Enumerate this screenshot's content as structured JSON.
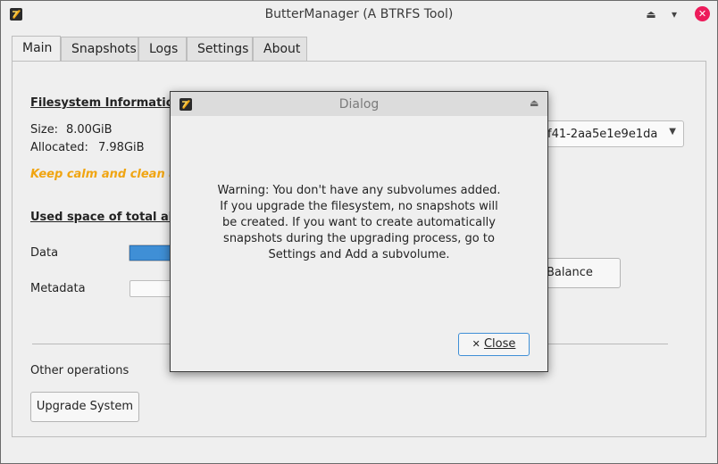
{
  "window": {
    "title": "ButterManager (A BTRFS Tool)"
  },
  "tabs": [
    "Main",
    "Snapshots",
    "Logs",
    "Settings",
    "About"
  ],
  "main": {
    "fs_heading": "Filesystem Information",
    "size_label": "Size:",
    "size_value": "8.00GiB",
    "allocated_label": "Allocated:",
    "allocated_value": "7.98GiB",
    "motto": "Keep calm and clean a litt",
    "uuid_value": "f41-2aa5e1e9e1da",
    "used_space_heading": "Used space of total alloc",
    "data_label": "Data",
    "metadata_label": "Metadata",
    "data_fill_fraction": 1.0,
    "balance_button": "Balance",
    "other_ops_label": "Other operations",
    "upgrade_button": "Upgrade System"
  },
  "dialog": {
    "title": "Dialog",
    "message": "Warning: You don't have any subvolumes added.\nIf you upgrade the filesystem, no snapshots will\nbe created. If you want to create automatically\nsnapshots during the upgrading process, go to\nSettings and Add a subvolume.",
    "close_button": "Close"
  },
  "colors": {
    "accent": "#3f8fd6",
    "motto": "#f0a512",
    "close": "#ed1c5b"
  }
}
